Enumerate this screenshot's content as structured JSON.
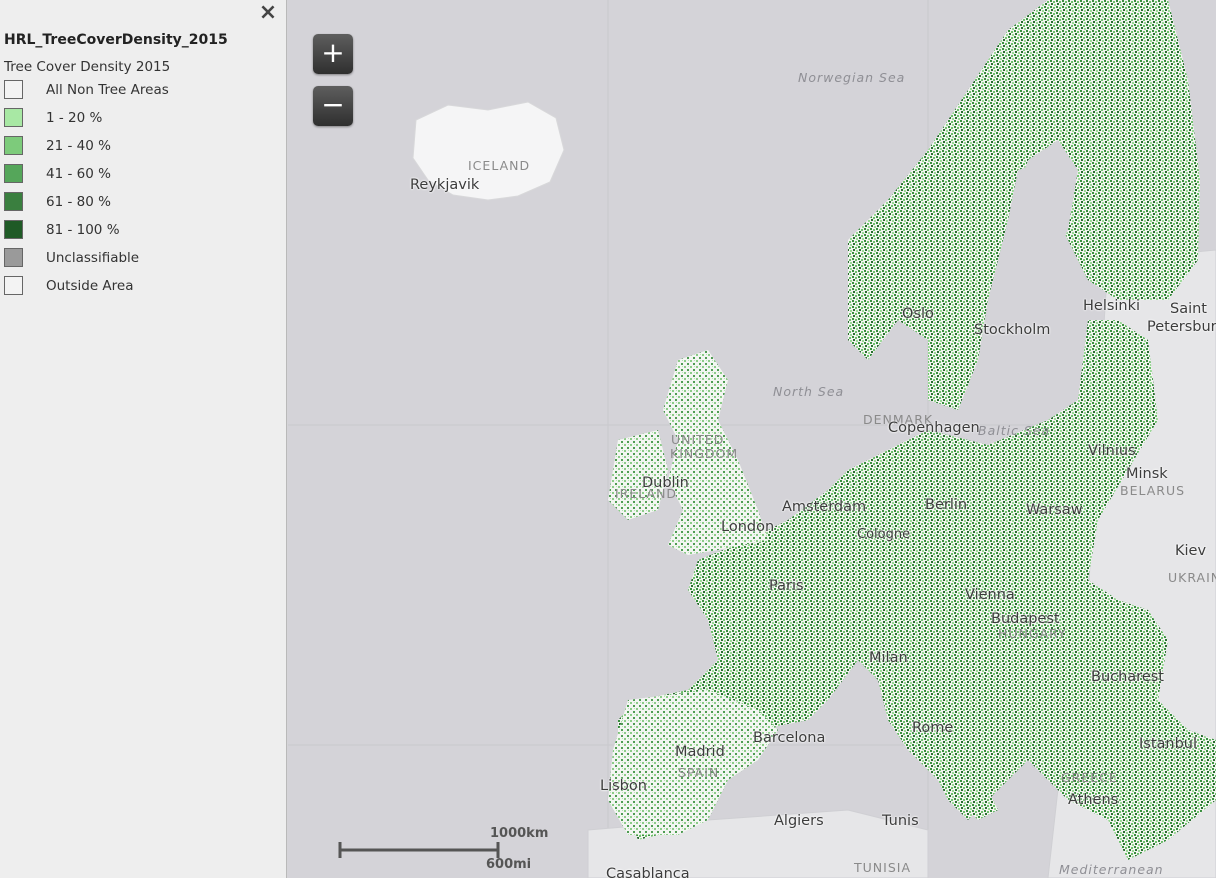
{
  "legend": {
    "close_icon": "×",
    "layer_title": "HRL_TreeCoverDensity_2015",
    "subtitle": "Tree Cover Density 2015",
    "items": [
      {
        "label": "All Non Tree Areas",
        "color": "#f3f3f3"
      },
      {
        "label": "1 - 20 %",
        "color": "#a8e8a4"
      },
      {
        "label": "21 - 40 %",
        "color": "#7dcb7b"
      },
      {
        "label": "41 - 60 %",
        "color": "#55a65a"
      },
      {
        "label": "61 - 80 %",
        "color": "#3a7f3f"
      },
      {
        "label": "81 - 100 %",
        "color": "#1f5a26"
      },
      {
        "label": "Unclassifiable",
        "color": "#9a9a9a"
      },
      {
        "label": "Outside Area",
        "color": "#f3f3f3"
      }
    ]
  },
  "zoom": {
    "in_label": "+",
    "out_label": "−"
  },
  "labels": {
    "norwegian_sea": "Norwegian Sea",
    "iceland": "ICELAND",
    "reykjavik": "Reykjavik",
    "helsinki": "Helsinki",
    "saint": "Saint",
    "petersburg": "Petersburg",
    "oslo": "Oslo",
    "stockholm": "Stockholm",
    "north_sea": "North Sea",
    "denmark": "DENMARK",
    "copenhagen": "Copenhagen",
    "baltic_sea": "Baltic Sea",
    "vilnius": "Vilnius",
    "minsk": "Minsk",
    "belarus": "BELARUS",
    "united": "UNITED",
    "kingdom": "KINGDOM",
    "ireland": "IRELAND",
    "dublin": "Dublin",
    "amsterdam": "Amsterdam",
    "berlin": "Berlin",
    "warsaw": "Warsaw",
    "london": "London",
    "cologne": "Cologne",
    "kiev": "Kiev",
    "ukraine": "UKRAINE",
    "paris": "Paris",
    "vienna": "Vienna",
    "budapest": "Budapest",
    "hungary": "HUNGARY",
    "milan": "Milan",
    "bucharest": "Bucharest",
    "madrid": "Madrid",
    "spain": "SPAIN",
    "barcelona": "Barcelona",
    "rome": "Rome",
    "istanbul": "Istanbul",
    "lisbon": "Lisbon",
    "greece": "GREECE",
    "athens": "Athens",
    "algiers": "Algiers",
    "tunis": "Tunis",
    "tunisia": "TUNISIA",
    "casablanca": "Casablanca",
    "mediterranean": "Mediterranean"
  },
  "scale": {
    "km": "1000km",
    "mi": "600mi"
  }
}
